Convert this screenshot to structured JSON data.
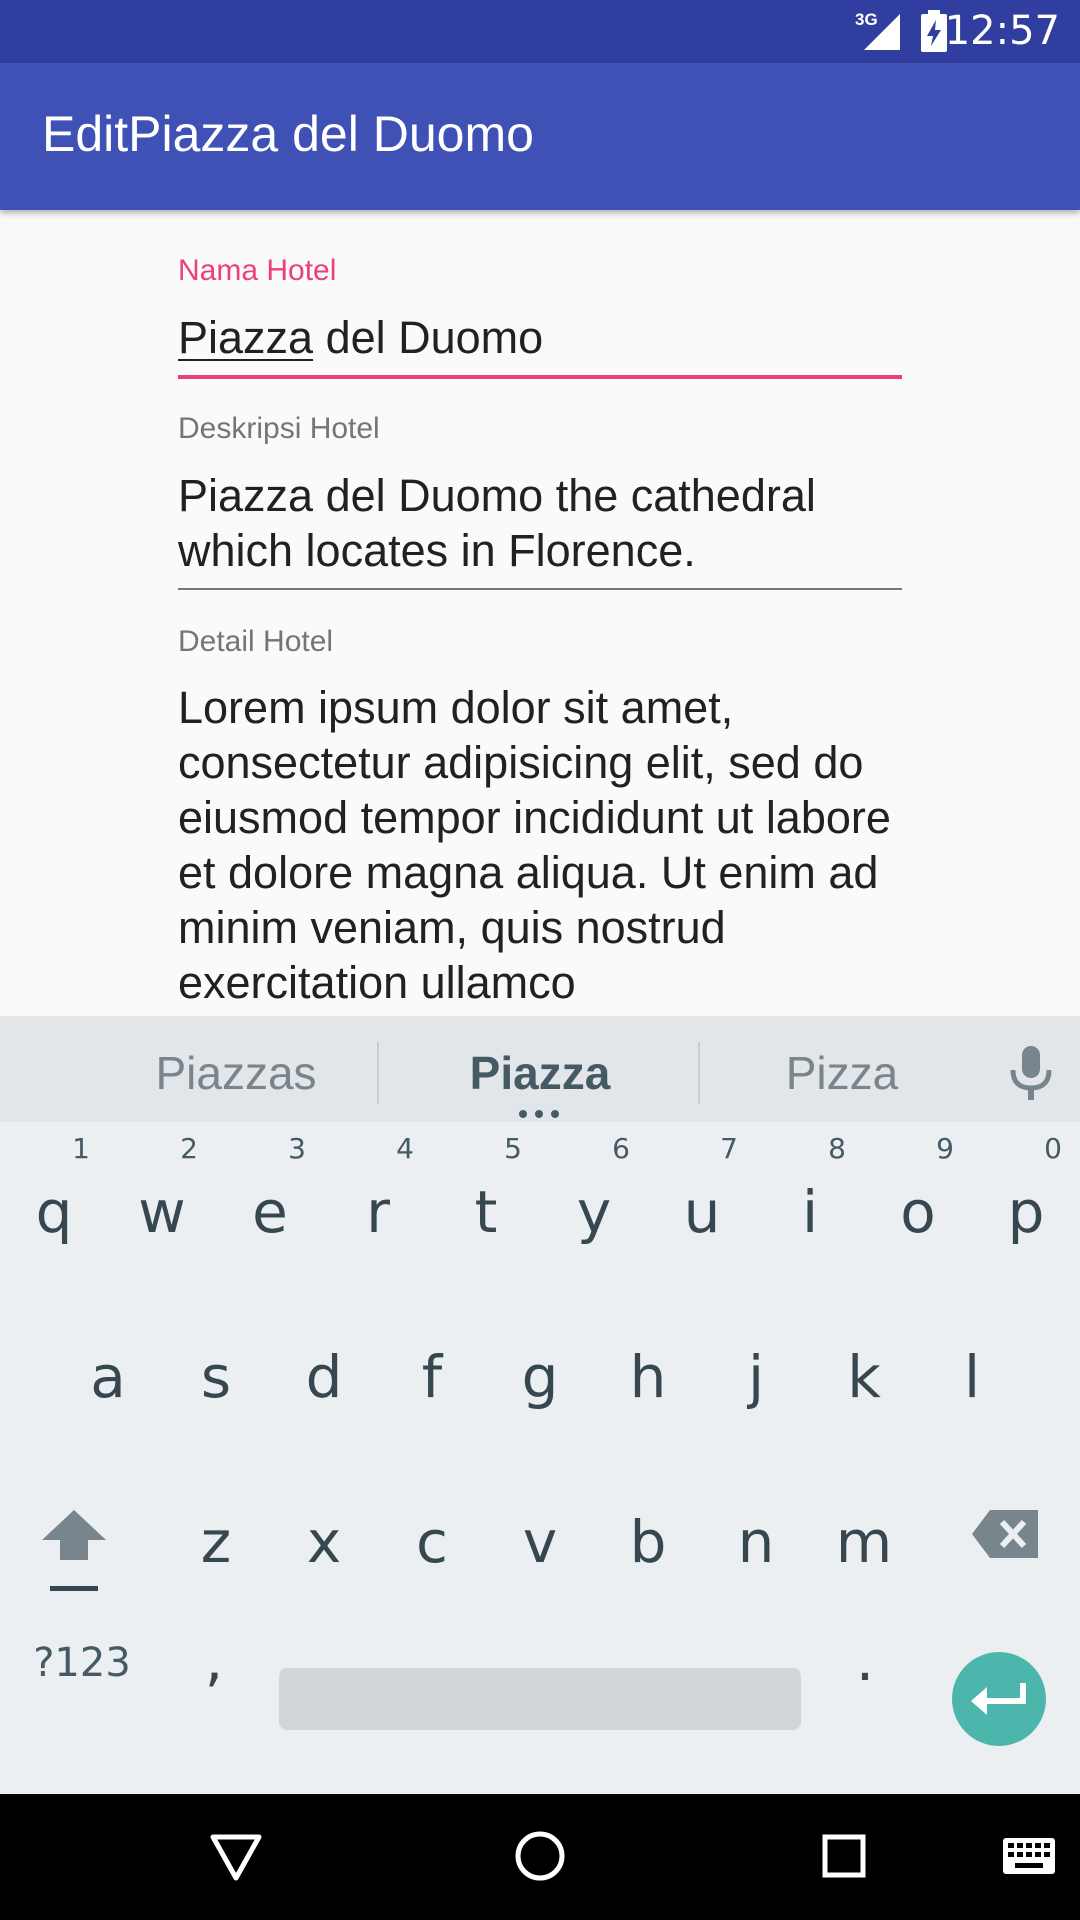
{
  "status_bar": {
    "network": "3G",
    "time": "12:57"
  },
  "app_bar": {
    "title": "EditPiazza del Duomo"
  },
  "form": {
    "name": {
      "label": "Nama Hotel",
      "value_underlined": "Piazza",
      "value_rest": " del Duomo"
    },
    "description": {
      "label": "Deskripsi Hotel",
      "value": "Piazza del Duomo the cathedral which locates in Florence."
    },
    "detail": {
      "label": "Detail Hotel",
      "value": "Lorem ipsum dolor sit amet, consectetur adipisicing elit, sed do eiusmod tempor incididunt ut labore et dolore magna aliqua. Ut enim ad minim veniam, quis nostrud exercitation ullamco"
    }
  },
  "keyboard": {
    "suggestions": [
      "Piazzas",
      "Piazza",
      "Pizza"
    ],
    "row1": [
      {
        "k": "q",
        "h": "1"
      },
      {
        "k": "w",
        "h": "2"
      },
      {
        "k": "e",
        "h": "3"
      },
      {
        "k": "r",
        "h": "4"
      },
      {
        "k": "t",
        "h": "5"
      },
      {
        "k": "y",
        "h": "6"
      },
      {
        "k": "u",
        "h": "7"
      },
      {
        "k": "i",
        "h": "8"
      },
      {
        "k": "o",
        "h": "9"
      },
      {
        "k": "p",
        "h": "0"
      }
    ],
    "row2": [
      "a",
      "s",
      "d",
      "f",
      "g",
      "h",
      "j",
      "k",
      "l"
    ],
    "row3": [
      "z",
      "x",
      "c",
      "v",
      "b",
      "n",
      "m"
    ],
    "symbols_label": "?123",
    "comma": ",",
    "period": "."
  },
  "colors": {
    "status_bar": "#303f9f",
    "app_bar": "#3f51b5",
    "accent": "#ec407a",
    "enter_key": "#4db6ac"
  }
}
